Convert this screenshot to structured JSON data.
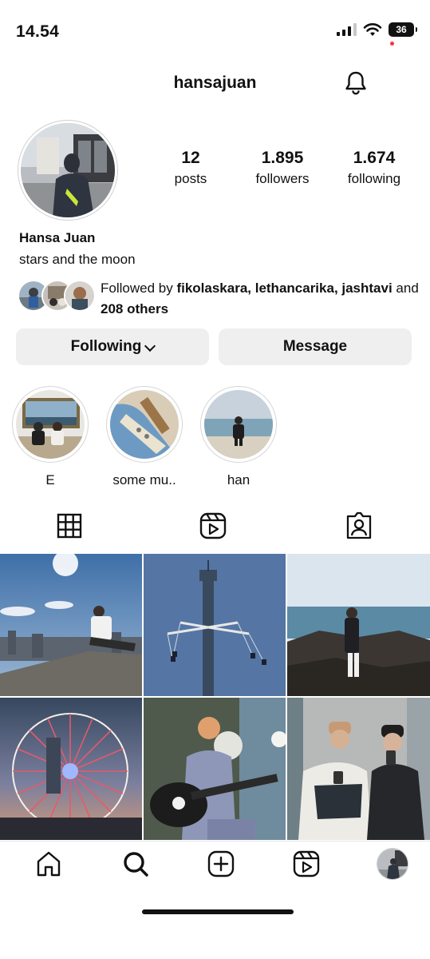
{
  "status_bar": {
    "time": "14.54",
    "battery": "36"
  },
  "header": {
    "username": "hansajuan"
  },
  "profile": {
    "stats": [
      {
        "value": "12",
        "label": "posts"
      },
      {
        "value": "1.895",
        "label": "followers"
      },
      {
        "value": "1.674",
        "label": "following"
      }
    ],
    "display_name": "Hansa Juan",
    "bio": "stars and the moon",
    "followed_by": {
      "prefix": "Followed by ",
      "names": "fikolaskara, lethancarika, jashtavi",
      "and": " and ",
      "others": "208 others"
    }
  },
  "buttons": {
    "following": "Following",
    "message": "Message"
  },
  "highlights": [
    {
      "label": "E"
    },
    {
      "label": "some mu.."
    },
    {
      "label": "han"
    }
  ],
  "tabs": {
    "icons": [
      "grid-icon",
      "reels-icon",
      "tagged-icon"
    ]
  },
  "bottom_nav": {
    "icons": [
      "home-icon",
      "search-icon",
      "create-icon",
      "reels-icon",
      "profile-avatar"
    ]
  },
  "colors": {
    "button_bg": "#efefef",
    "notification_dot": "#ff3040"
  }
}
